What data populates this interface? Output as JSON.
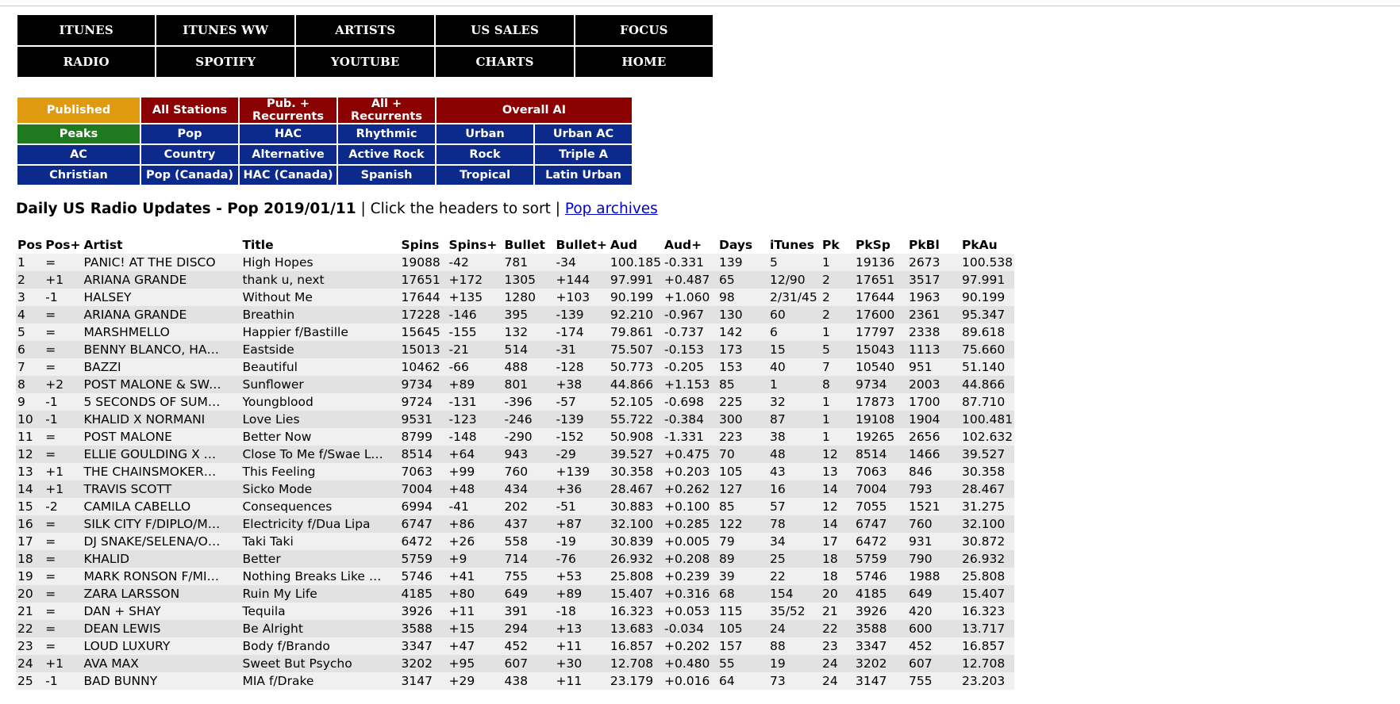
{
  "nav": {
    "row1": [
      "ITUNES",
      "ITUNES WW",
      "ARTISTS",
      "US SALES",
      "FOCUS"
    ],
    "row2": [
      "RADIO",
      "SPOTIFY",
      "YOUTUBE",
      "CHARTS",
      "HOME"
    ]
  },
  "stations": {
    "row1": [
      "Published",
      "All Stations",
      "Pub. + Recurrents",
      "All + Recurrents",
      "Overall AI"
    ],
    "row2": [
      "Peaks",
      "Pop",
      "HAC",
      "Rhythmic",
      "Urban",
      "Urban AC"
    ],
    "row3": [
      "AC",
      "Country",
      "Alternative",
      "Active Rock",
      "Rock",
      "Triple A"
    ],
    "row4": [
      "Christian",
      "Pop (Canada)",
      "HAC (Canada)",
      "Spanish",
      "Tropical",
      "Latin Urban"
    ]
  },
  "colors": {
    "published": "#e09a10",
    "dark_red": "#8b0000",
    "green": "#1f7a1f",
    "blue": "#0b2a8c"
  },
  "heading": {
    "title": "Daily US Radio Updates - Pop 2019/01/11",
    "sort_hint": " | Click the headers to sort | ",
    "archives_link": "Pop archives"
  },
  "table": {
    "headers": [
      "Pos",
      "Pos+",
      "Artist",
      "Title",
      "Spins",
      "Spins+",
      "Bullet",
      "Bullet+",
      "Aud",
      "Aud+",
      "Days",
      "iTunes",
      "Pk",
      "PkSp",
      "PkBl",
      "PkAu"
    ],
    "rows": [
      [
        "1",
        "=",
        "PANIC! AT THE DISCO",
        "High Hopes",
        "19088",
        "-42",
        "781",
        "-34",
        "100.185",
        "-0.331",
        "139",
        "5",
        "1",
        "19136",
        "2673",
        "100.538"
      ],
      [
        "2",
        "+1",
        "ARIANA GRANDE",
        "thank u, next",
        "17651",
        "+172",
        "1305",
        "+144",
        "97.991",
        "+0.487",
        "65",
        "12/90",
        "2",
        "17651",
        "3517",
        "97.991"
      ],
      [
        "3",
        "-1",
        "HALSEY",
        "Without Me",
        "17644",
        "+135",
        "1280",
        "+103",
        "90.199",
        "+1.060",
        "98",
        "2/31/45",
        "2",
        "17644",
        "1963",
        "90.199"
      ],
      [
        "4",
        "=",
        "ARIANA GRANDE",
        "Breathin",
        "17228",
        "-146",
        "395",
        "-139",
        "92.210",
        "-0.967",
        "130",
        "60",
        "2",
        "17600",
        "2361",
        "95.347"
      ],
      [
        "5",
        "=",
        "MARSHMELLO",
        "Happier f/Bastille",
        "15645",
        "-155",
        "132",
        "-174",
        "79.861",
        "-0.737",
        "142",
        "6",
        "1",
        "17797",
        "2338",
        "89.618"
      ],
      [
        "6",
        "=",
        "BENNY BLANCO, HALSEY & KHALID",
        "Eastside",
        "15013",
        "-21",
        "514",
        "-31",
        "75.507",
        "-0.153",
        "173",
        "15",
        "5",
        "15043",
        "1113",
        "75.660"
      ],
      [
        "7",
        "=",
        "BAZZI",
        "Beautiful",
        "10462",
        "-66",
        "488",
        "-128",
        "50.773",
        "-0.205",
        "153",
        "40",
        "7",
        "10540",
        "951",
        "51.140"
      ],
      [
        "8",
        "+2",
        "POST MALONE & SWAE LEE",
        "Sunflower",
        "9734",
        "+89",
        "801",
        "+38",
        "44.866",
        "+1.153",
        "85",
        "1",
        "8",
        "9734",
        "2003",
        "44.866"
      ],
      [
        "9",
        "-1",
        "5 SECONDS OF SUMMER",
        "Youngblood",
        "9724",
        "-131",
        "-396",
        "-57",
        "52.105",
        "-0.698",
        "225",
        "32",
        "1",
        "17873",
        "1700",
        "87.710"
      ],
      [
        "10",
        "-1",
        "KHALID X NORMANI",
        "Love Lies",
        "9531",
        "-123",
        "-246",
        "-139",
        "55.722",
        "-0.384",
        "300",
        "87",
        "1",
        "19108",
        "1904",
        "100.481"
      ],
      [
        "11",
        "=",
        "POST MALONE",
        "Better Now",
        "8799",
        "-148",
        "-290",
        "-152",
        "50.908",
        "-1.331",
        "223",
        "38",
        "1",
        "19265",
        "2656",
        "102.632"
      ],
      [
        "12",
        "=",
        "ELLIE GOULDING X DIPLO",
        "Close To Me f/Swae Lee",
        "8514",
        "+64",
        "943",
        "-29",
        "39.527",
        "+0.475",
        "70",
        "48",
        "12",
        "8514",
        "1466",
        "39.527"
      ],
      [
        "13",
        "+1",
        "THE CHAINSMOKERS F/KYGO",
        "This Feeling",
        "7063",
        "+99",
        "760",
        "+139",
        "30.358",
        "+0.203",
        "105",
        "43",
        "13",
        "7063",
        "846",
        "30.358"
      ],
      [
        "14",
        "+1",
        "TRAVIS SCOTT",
        "Sicko Mode",
        "7004",
        "+48",
        "434",
        "+36",
        "28.467",
        "+0.262",
        "127",
        "16",
        "14",
        "7004",
        "793",
        "28.467"
      ],
      [
        "15",
        "-2",
        "CAMILA CABELLO",
        "Consequences",
        "6994",
        "-41",
        "202",
        "-51",
        "30.883",
        "+0.100",
        "85",
        "57",
        "12",
        "7055",
        "1521",
        "31.275"
      ],
      [
        "16",
        "=",
        "SILK CITY F/DIPLO/MARK RONSON",
        "Electricity f/Dua Lipa",
        "6747",
        "+86",
        "437",
        "+87",
        "32.100",
        "+0.285",
        "122",
        "78",
        "14",
        "6747",
        "760",
        "32.100"
      ],
      [
        "17",
        "=",
        "DJ SNAKE/SELENA/OZUNA/CARDI B",
        "Taki Taki",
        "6472",
        "+26",
        "558",
        "-19",
        "30.839",
        "+0.005",
        "79",
        "34",
        "17",
        "6472",
        "931",
        "30.872"
      ],
      [
        "18",
        "=",
        "KHALID",
        "Better",
        "5759",
        "+9",
        "714",
        "-76",
        "26.932",
        "+0.208",
        "89",
        "25",
        "18",
        "5759",
        "790",
        "26.932"
      ],
      [
        "19",
        "=",
        "MARK RONSON F/MILEY CYRUS",
        "Nothing Breaks Like A Heart",
        "5746",
        "+41",
        "755",
        "+53",
        "25.808",
        "+0.239",
        "39",
        "22",
        "18",
        "5746",
        "1988",
        "25.808"
      ],
      [
        "20",
        "=",
        "ZARA LARSSON",
        "Ruin My Life",
        "4185",
        "+80",
        "649",
        "+89",
        "15.407",
        "+0.316",
        "68",
        "154",
        "20",
        "4185",
        "649",
        "15.407"
      ],
      [
        "21",
        "=",
        "DAN + SHAY",
        "Tequila",
        "3926",
        "+11",
        "391",
        "-18",
        "16.323",
        "+0.053",
        "115",
        "35/52",
        "21",
        "3926",
        "420",
        "16.323"
      ],
      [
        "22",
        "=",
        "DEAN LEWIS",
        "Be Alright",
        "3588",
        "+15",
        "294",
        "+13",
        "13.683",
        "-0.034",
        "105",
        "24",
        "22",
        "3588",
        "600",
        "13.717"
      ],
      [
        "23",
        "=",
        "LOUD LUXURY",
        "Body f/Brando",
        "3347",
        "+47",
        "452",
        "+11",
        "16.857",
        "+0.202",
        "157",
        "88",
        "23",
        "3347",
        "452",
        "16.857"
      ],
      [
        "24",
        "+1",
        "AVA MAX",
        "Sweet But Psycho",
        "3202",
        "+95",
        "607",
        "+30",
        "12.708",
        "+0.480",
        "55",
        "19",
        "24",
        "3202",
        "607",
        "12.708"
      ],
      [
        "25",
        "-1",
        "BAD BUNNY",
        "MIA f/Drake",
        "3147",
        "+29",
        "438",
        "+11",
        "23.179",
        "+0.016",
        "64",
        "73",
        "24",
        "3147",
        "755",
        "23.203"
      ]
    ]
  }
}
